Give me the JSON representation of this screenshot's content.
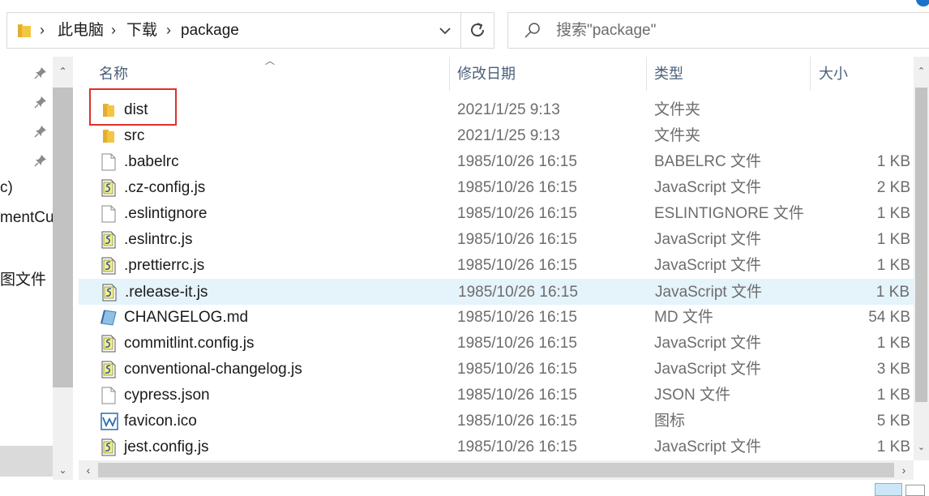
{
  "address": {
    "crumbs": [
      "此电脑",
      "下载",
      "package"
    ],
    "separator": ">"
  },
  "search": {
    "placeholder": "搜索\"package\""
  },
  "nav": {
    "items": [
      "c)",
      "mentCul",
      "图文件"
    ]
  },
  "columns": {
    "name": "名称",
    "date": "修改日期",
    "type": "类型",
    "size": "大小"
  },
  "files": [
    {
      "name": "dist",
      "date": "2021/1/25 9:13",
      "type": "文件夹",
      "size": "",
      "icon": "folder-icon"
    },
    {
      "name": "src",
      "date": "2021/1/25 9:13",
      "type": "文件夹",
      "size": "",
      "icon": "folder-icon"
    },
    {
      "name": ".babelrc",
      "date": "1985/10/26 16:15",
      "type": "BABELRC 文件",
      "size": "1 KB",
      "icon": "blank-file-icon"
    },
    {
      "name": ".cz-config.js",
      "date": "1985/10/26 16:15",
      "type": "JavaScript 文件",
      "size": "2 KB",
      "icon": "js-file-icon"
    },
    {
      "name": ".eslintignore",
      "date": "1985/10/26 16:15",
      "type": "ESLINTIGNORE 文件",
      "size": "1 KB",
      "icon": "blank-file-icon"
    },
    {
      "name": ".eslintrc.js",
      "date": "1985/10/26 16:15",
      "type": "JavaScript 文件",
      "size": "1 KB",
      "icon": "js-file-icon"
    },
    {
      "name": ".prettierrc.js",
      "date": "1985/10/26 16:15",
      "type": "JavaScript 文件",
      "size": "1 KB",
      "icon": "js-file-icon"
    },
    {
      "name": ".release-it.js",
      "date": "1985/10/26 16:15",
      "type": "JavaScript 文件",
      "size": "1 KB",
      "icon": "js-file-icon"
    },
    {
      "name": "CHANGELOG.md",
      "date": "1985/10/26 16:15",
      "type": "MD 文件",
      "size": "54 KB",
      "icon": "md-file-icon"
    },
    {
      "name": "commitlint.config.js",
      "date": "1985/10/26 16:15",
      "type": "JavaScript 文件",
      "size": "1 KB",
      "icon": "js-file-icon"
    },
    {
      "name": "conventional-changelog.js",
      "date": "1985/10/26 16:15",
      "type": "JavaScript 文件",
      "size": "3 KB",
      "icon": "js-file-icon"
    },
    {
      "name": "cypress.json",
      "date": "1985/10/26 16:15",
      "type": "JSON 文件",
      "size": "1 KB",
      "icon": "blank-file-icon"
    },
    {
      "name": "favicon.ico",
      "date": "1985/10/26 16:15",
      "type": "图标",
      "size": "5 KB",
      "icon": "ico-file-icon"
    },
    {
      "name": "jest.config.js",
      "date": "1985/10/26 16:15",
      "type": "JavaScript 文件",
      "size": "1 KB",
      "icon": "js-file-icon"
    }
  ],
  "selected_file": ".release-it.js",
  "highlighted_file": "dist",
  "colors": {
    "selection": "#e5f3fb",
    "highlight_border": "#e0302b",
    "header_text": "#4c607a",
    "folder": "#f4c542"
  }
}
